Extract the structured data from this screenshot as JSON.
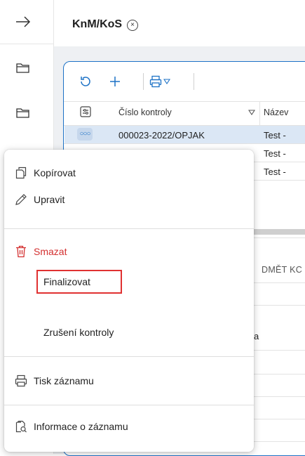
{
  "header": {
    "title": "KnM/KoS",
    "close_glyph": "×"
  },
  "table": {
    "header": {
      "col1": "Číslo kontroly",
      "col2": "Název"
    },
    "rows": [
      {
        "id": "000023-2022/OPJAK",
        "name": "Test -"
      },
      {
        "id": "",
        "name": "Test -"
      },
      {
        "id": "",
        "name": "Test -"
      }
    ],
    "section_label": "DMĚT KC",
    "partial_char": "a"
  },
  "menu": {
    "copy": "Kopírovat",
    "edit": "Upravit",
    "delete": "Smazat",
    "finalize": "Finalizovat",
    "cancel_control": "Zrušení kontroly",
    "print": "Tisk záznamu",
    "info": "Informace o záznamu"
  },
  "colors": {
    "accent": "#1d72c6",
    "danger": "#d32f2f",
    "highlight": "#e03131",
    "selected_row": "#dbe7f5"
  }
}
